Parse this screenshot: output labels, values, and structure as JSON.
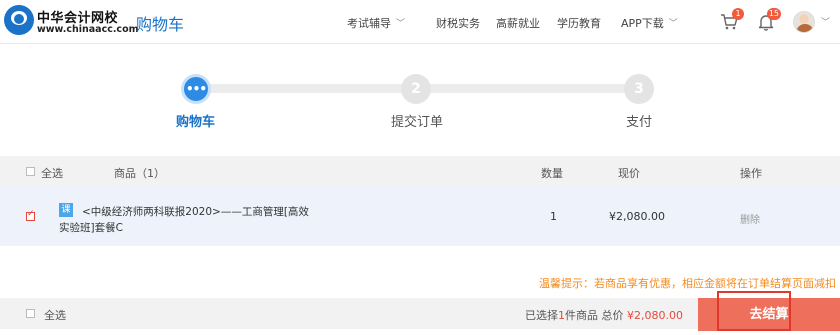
{
  "header": {
    "logo_cn": "中华会计网校",
    "logo_en": "www.chinaacc.com",
    "page_title": "购物车",
    "nav": [
      {
        "label": "考试辅导",
        "has_dropdown": true
      },
      {
        "label": "财税实务",
        "has_dropdown": false
      },
      {
        "label": "高薪就业",
        "has_dropdown": false
      },
      {
        "label": "学历教育",
        "has_dropdown": false
      },
      {
        "label": "APP下载",
        "has_dropdown": true
      }
    ],
    "cart_badge": "1",
    "bell_badge": "15",
    "icons": [
      "cart-icon",
      "bell-icon",
      "avatar",
      "chevron-down-icon"
    ]
  },
  "steps": [
    {
      "label": "购物车",
      "marker": "•••",
      "active": true
    },
    {
      "label": "提交订单",
      "marker": "2",
      "active": false
    },
    {
      "label": "支付",
      "marker": "3",
      "active": false
    }
  ],
  "table": {
    "select_all": "全选",
    "columns": [
      "商品（1）",
      "数量",
      "现价",
      "操作"
    ],
    "rows": [
      {
        "checked": true,
        "tag": "课",
        "title_line1": "<中级经济师两科联报2020>——工商管理[高效",
        "title_line2": "实验班]套餐C",
        "quantity": "1",
        "price": "¥2,080.00",
        "action": "删除"
      }
    ]
  },
  "tip": "温馨提示：若商品享有优惠，相应金额将在订单结算页面减扣",
  "footer": {
    "select_all": "全选",
    "selected_prefix": "已选择",
    "selected_count": "1",
    "selected_suffix": "件商品 总价",
    "total": "¥2,080.00",
    "checkout_label": "去结算"
  },
  "colors": {
    "brand_blue": "#1a73c9",
    "step_active": "#2d8be6",
    "checkout_bg": "#ee6f5c",
    "highlight_frame": "#e2372a",
    "tip_orange": "#f58b1f",
    "price_red": "#e64a3c"
  }
}
